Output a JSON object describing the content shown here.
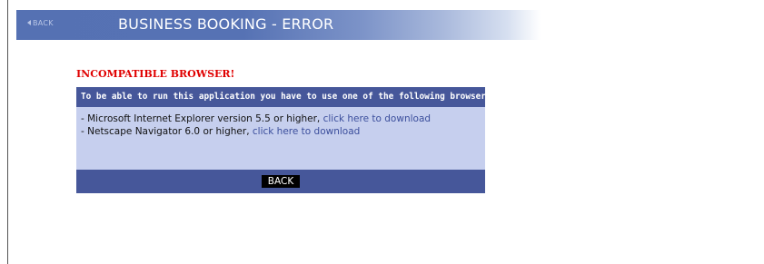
{
  "header": {
    "back_label": "BACK",
    "title": "BUSINESS BOOKING - ERROR"
  },
  "error": {
    "heading": "INCOMPATIBLE BROWSER!",
    "message": "To be able to run this application you have to use one of the following browsers:",
    "browsers": [
      {
        "text": "- Microsoft Internet Explorer version 5.5 or higher, ",
        "link": "click here to download"
      },
      {
        "text": "- Netscape Navigator 6.0 or higher, ",
        "link": "click here to download"
      }
    ],
    "back_button": "BACK"
  },
  "colors": {
    "header_bar": "#5571b3",
    "error_red": "#e00000",
    "panel_bg": "#c6cfee",
    "panel_bar": "#46579a",
    "link": "#3b4e9c"
  }
}
